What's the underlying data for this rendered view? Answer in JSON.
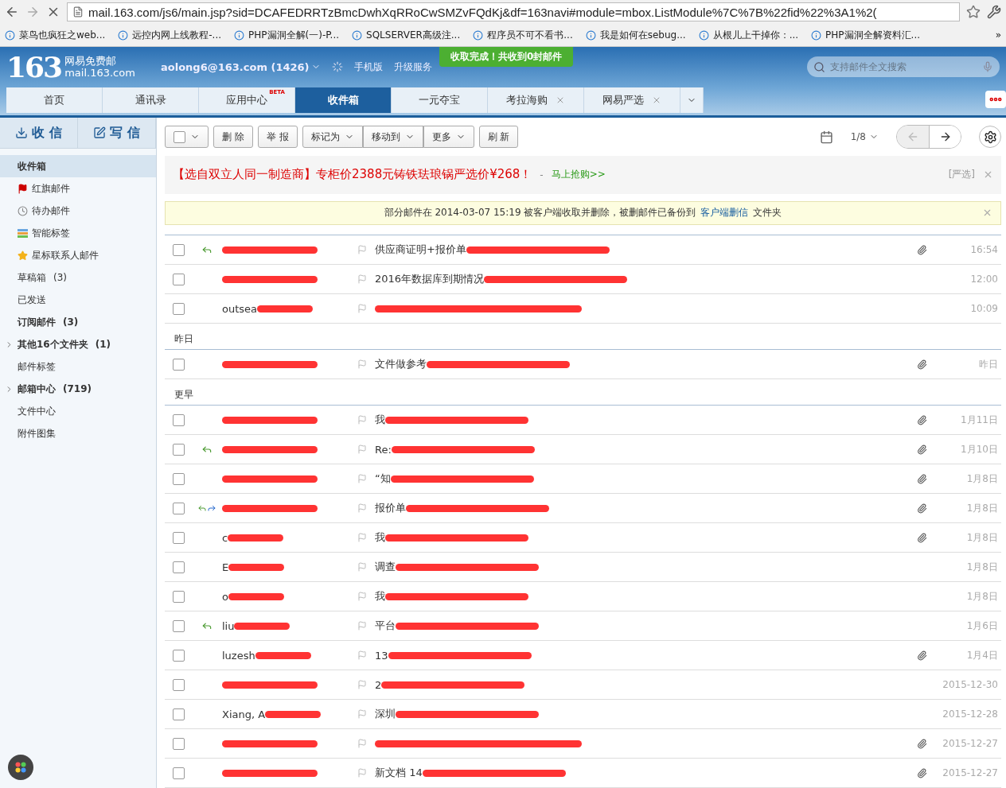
{
  "browser": {
    "url": "mail.163.com/js6/main.jsp?sid=DCAFEDRRTzBmcDwhXqRRoCwSMZvFQdKj&df=163navi#module=mbox.ListModule%7C%7B%22fid%22%3A1%2(",
    "bookmarks": [
      "菜鸟也疯狂之web...",
      "远控内网上线教程-...",
      "PHP漏洞全解(一)-P...",
      "SQLSERVER高级注...",
      "程序员不可不看书...",
      "我是如何在sebug...",
      "从根儿上干掉你：...",
      "PHP漏洞全解资料汇..."
    ],
    "more": "»"
  },
  "header": {
    "logo_number": "163",
    "logo_title": "网易免费邮",
    "logo_domain": "mail.163.com",
    "account": "aolong6@163.com (1426)",
    "links": [
      "手机版",
      "升级服务"
    ],
    "toast": "收取完成！共收到0封邮件",
    "search": {
      "placeholder": "支持邮件全文搜索"
    }
  },
  "tabs": [
    {
      "label": "首页",
      "selected": false,
      "closable": false
    },
    {
      "label": "通讯录",
      "selected": false,
      "closable": false
    },
    {
      "label": "应用中心",
      "selected": false,
      "closable": false,
      "badge": "BETA"
    },
    {
      "label": "收件箱",
      "selected": true,
      "closable": false
    },
    {
      "label": "一元夺宝",
      "selected": false,
      "closable": false
    },
    {
      "label": "考拉海购",
      "selected": false,
      "closable": true
    },
    {
      "label": "网易严选",
      "selected": false,
      "closable": true
    }
  ],
  "sidebar": {
    "receive": "收 信",
    "compose": "写 信",
    "items": [
      {
        "label": "收件箱",
        "kind": "plain",
        "selected": true,
        "expandable": false,
        "bold": true
      },
      {
        "label": "红旗邮件",
        "kind": "flag",
        "selected": false,
        "expandable": false,
        "bold": false
      },
      {
        "label": "待办邮件",
        "kind": "clock",
        "selected": false,
        "expandable": false,
        "bold": false
      },
      {
        "label": "智能标签",
        "kind": "tags",
        "selected": false,
        "expandable": false,
        "bold": false
      },
      {
        "label": "星标联系人邮件",
        "kind": "star",
        "selected": false,
        "expandable": false,
        "bold": false
      },
      {
        "label": "草稿箱",
        "count": "(3)",
        "kind": "plain",
        "selected": false,
        "expandable": false,
        "bold": false
      },
      {
        "label": "已发送",
        "kind": "plain",
        "selected": false,
        "expandable": false,
        "bold": false
      },
      {
        "label": "订阅邮件",
        "count": "(3)",
        "kind": "plain",
        "selected": false,
        "expandable": false,
        "bold": true
      },
      {
        "label": "其他16个文件夹",
        "count": "(1)",
        "kind": "plain",
        "selected": false,
        "expandable": true,
        "bold": true
      },
      {
        "label": "邮件标签",
        "kind": "plain",
        "selected": false,
        "expandable": false,
        "bold": false
      },
      {
        "label": "邮箱中心",
        "count": "(719)",
        "kind": "plain",
        "selected": false,
        "expandable": true,
        "bold": true
      },
      {
        "label": "文件中心",
        "kind": "plain",
        "selected": false,
        "expandable": false,
        "bold": false
      },
      {
        "label": "附件图集",
        "kind": "plain",
        "selected": false,
        "expandable": false,
        "bold": false
      }
    ]
  },
  "toolbar": {
    "buttons": [
      {
        "label": "删 除",
        "dropdown": false
      },
      {
        "label": "举 报",
        "dropdown": false
      },
      {
        "label": "标记为",
        "dropdown": true
      },
      {
        "label": "移动到",
        "dropdown": true
      },
      {
        "label": "更多",
        "dropdown": true
      },
      {
        "label": "刷 新",
        "dropdown": false
      }
    ],
    "page": "1/8"
  },
  "ad": {
    "text": "【选自双立人同一制造商】专柜价2388元铸铁珐琅锅严选价¥268！",
    "dash": "-",
    "link": "马上抢购>>",
    "source": "[严选]"
  },
  "notice": {
    "text": "部分邮件在 2014-03-07 15:19 被客户端收取并删除，被删邮件已备份到",
    "link": "客户端删信",
    "suffix": "文件夹"
  },
  "groups": [
    {
      "emails": [
        {
          "subject": "供应商证明+报价单",
          "date": "16:54",
          "checked": false,
          "replied": true,
          "forwarded": false,
          "attachment": true
        },
        {
          "subject": "2016年数据库到期情况",
          "date": "12:00",
          "checked": false,
          "replied": false,
          "forwarded": false,
          "attachment": false
        },
        {
          "sender": "outsea",
          "date": "10:09",
          "checked": false,
          "replied": false,
          "forwarded": false,
          "attachment": false
        }
      ]
    },
    {
      "label": "昨日",
      "emails": [
        {
          "subject": "文件做参考",
          "date": "昨日",
          "checked": false,
          "replied": false,
          "forwarded": false,
          "attachment": true
        }
      ]
    },
    {
      "label": "更早",
      "emails": [
        {
          "subject": "我",
          "date": "1月11日",
          "checked": false,
          "replied": false,
          "forwarded": false,
          "attachment": true
        },
        {
          "subject": "Re:",
          "date": "1月10日",
          "checked": false,
          "replied": true,
          "forwarded": false,
          "attachment": true
        },
        {
          "subject": "“知",
          "date": "1月8日",
          "checked": false,
          "replied": false,
          "forwarded": false,
          "attachment": true
        },
        {
          "subject": "报价单",
          "date": "1月8日",
          "checked": false,
          "replied": true,
          "forwarded": true,
          "attachment": true
        },
        {
          "sender": "c",
          "subject": "我",
          "date": "1月8日",
          "checked": false,
          "replied": false,
          "forwarded": false,
          "attachment": true
        },
        {
          "sender": "E",
          "subject": "调查",
          "date": "1月8日",
          "checked": false,
          "replied": false,
          "forwarded": false,
          "attachment": false
        },
        {
          "sender": "o",
          "subject": "我",
          "date": "1月8日",
          "checked": false,
          "replied": false,
          "forwarded": false,
          "attachment": false
        },
        {
          "sender": "liu",
          "subject": "平台",
          "date": "1月6日",
          "checked": false,
          "replied": true,
          "forwarded": false,
          "attachment": false
        },
        {
          "sender": "luzesh",
          "subject": "13",
          "date": "1月4日",
          "checked": false,
          "replied": false,
          "forwarded": false,
          "attachment": true
        },
        {
          "subject": "2",
          "date": "2015-12-30",
          "checked": false,
          "replied": false,
          "forwarded": false,
          "attachment": false
        },
        {
          "sender": "Xiang, A",
          "subject": "深圳",
          "date": "2015-12-28",
          "checked": false,
          "replied": false,
          "forwarded": false,
          "attachment": false
        },
        {
          "date": "2015-12-27",
          "checked": false,
          "replied": false,
          "forwarded": false,
          "attachment": true
        },
        {
          "subject": "新文档 14",
          "date": "2015-12-27",
          "checked": false,
          "replied": false,
          "forwarded": false,
          "attachment": true
        }
      ]
    }
  ]
}
